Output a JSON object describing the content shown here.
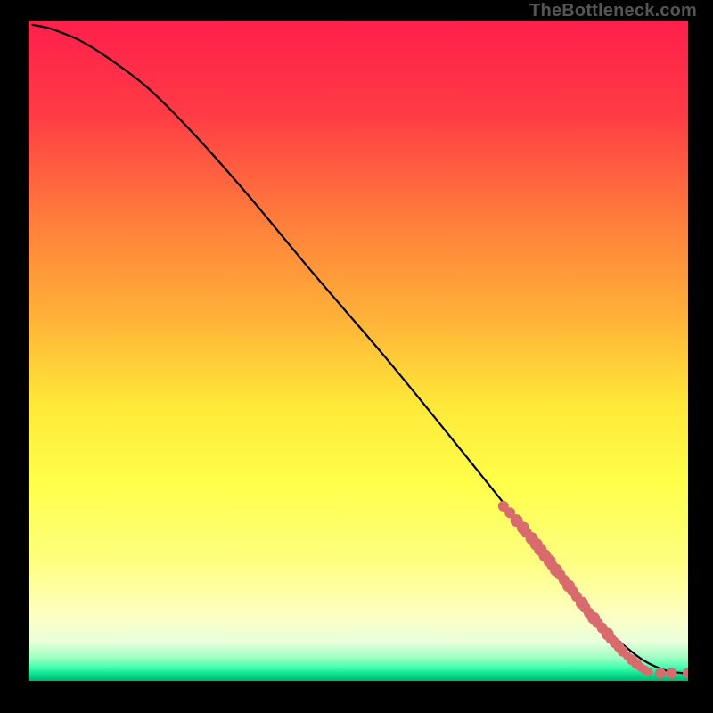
{
  "watermark": "TheBottleneck.com",
  "chart_data": {
    "type": "line",
    "title": "",
    "xlabel": "",
    "ylabel": "",
    "xlim": [
      0,
      100
    ],
    "ylim": [
      0,
      100
    ],
    "gradient_stops": [
      {
        "y": 100,
        "color": "#ff1f4b"
      },
      {
        "y": 86,
        "color": "#ff3b45"
      },
      {
        "y": 70,
        "color": "#ff7d3b"
      },
      {
        "y": 55,
        "color": "#ffb238"
      },
      {
        "y": 42,
        "color": "#ffe838"
      },
      {
        "y": 30,
        "color": "#ffff4a"
      },
      {
        "y": 18,
        "color": "#feff80"
      },
      {
        "y": 10,
        "color": "#fdffc2"
      },
      {
        "y": 6,
        "color": "#eaffdc"
      },
      {
        "y": 3.5,
        "color": "#9dffc2"
      },
      {
        "y": 2,
        "color": "#40ffb0"
      },
      {
        "y": 0.8,
        "color": "#00d98a"
      },
      {
        "y": 0,
        "color": "#00b46d"
      }
    ],
    "series": [
      {
        "name": "curve",
        "x": [
          0.5,
          3,
          5,
          8,
          12,
          18,
          25,
          33,
          43,
          55,
          68,
          80,
          86,
          92,
          96,
          99,
          100
        ],
        "y": [
          99.5,
          99,
          98.3,
          97,
          94.5,
          90,
          83,
          74,
          62,
          48,
          32,
          17,
          9.5,
          4,
          1.8,
          1.2,
          1.2
        ]
      }
    ],
    "scatter": [
      {
        "x": 72,
        "y": 26.5
      },
      {
        "x": 73,
        "y": 25.5
      },
      {
        "x": 74,
        "y": 24.3
      },
      {
        "x": 75,
        "y": 23.2
      },
      {
        "x": 75.5,
        "y": 22.5
      },
      {
        "x": 76.3,
        "y": 21.6
      },
      {
        "x": 77,
        "y": 20.7
      },
      {
        "x": 77.6,
        "y": 19.9
      },
      {
        "x": 78.3,
        "y": 19.0
      },
      {
        "x": 79,
        "y": 18.2
      },
      {
        "x": 79.4,
        "y": 17.5
      },
      {
        "x": 80,
        "y": 16.8
      },
      {
        "x": 80.6,
        "y": 16.1
      },
      {
        "x": 81.2,
        "y": 15.3
      },
      {
        "x": 81.9,
        "y": 14.4
      },
      {
        "x": 82.5,
        "y": 13.6
      },
      {
        "x": 83.1,
        "y": 12.8
      },
      {
        "x": 83.9,
        "y": 11.8
      },
      {
        "x": 84.4,
        "y": 11.1
      },
      {
        "x": 85,
        "y": 10.3
      },
      {
        "x": 85.7,
        "y": 9.5
      },
      {
        "x": 86.3,
        "y": 8.8
      },
      {
        "x": 87,
        "y": 8.0
      },
      {
        "x": 87.8,
        "y": 7.1
      },
      {
        "x": 88.3,
        "y": 6.4
      },
      {
        "x": 88.9,
        "y": 5.8
      },
      {
        "x": 89.5,
        "y": 5.2
      },
      {
        "x": 90.1,
        "y": 4.5
      },
      {
        "x": 90.8,
        "y": 3.8
      },
      {
        "x": 91.5,
        "y": 3.2
      },
      {
        "x": 92.2,
        "y": 2.6
      },
      {
        "x": 92.8,
        "y": 2.1
      },
      {
        "x": 93.4,
        "y": 1.7
      },
      {
        "x": 94,
        "y": 1.4
      },
      {
        "x": 95.8,
        "y": 1.2
      },
      {
        "x": 97.5,
        "y": 1.2
      },
      {
        "x": 100,
        "y": 1.2
      }
    ],
    "scatter_color": "#d96a6e",
    "scatter_radius_list": [
      6,
      6,
      7,
      7,
      6,
      7,
      7,
      7,
      7,
      7,
      6,
      7,
      6,
      6,
      7,
      6,
      6,
      7,
      6,
      6,
      7,
      6,
      6,
      7,
      6,
      6,
      6,
      6,
      5,
      6,
      6,
      5,
      5,
      5,
      6,
      6,
      6
    ],
    "curve_stroke": "#000000",
    "curve_width": 2.2
  }
}
